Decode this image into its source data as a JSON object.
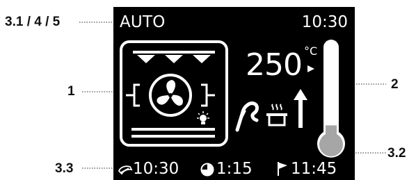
{
  "callouts": {
    "top_left": "3.1 / 4 / 5",
    "oven": "1",
    "thermometer": "2",
    "pot": "3.2",
    "bottom": "3.3"
  },
  "display": {
    "mode": "AUTO",
    "clock": "10:30",
    "temperature": "250",
    "temperature_unit": "°C",
    "cooking_time": "10:30",
    "duration": "1:15",
    "end_time": "11:45",
    "thermometer_level": 0.3
  },
  "icons": {
    "oven": "oven-fan-icon",
    "probe": "meat-probe-icon",
    "pot": "steaming-pot-icon",
    "arrow": "arrow-up-icon",
    "thermometer": "thermometer-icon",
    "cook_time": "cooking-time-icon",
    "duration": "duration-clock-icon",
    "end": "end-flag-icon"
  },
  "colors": {
    "display_bg": "#000000",
    "display_fg": "#ffffff",
    "thermo_fill": "#a6a6a6"
  }
}
